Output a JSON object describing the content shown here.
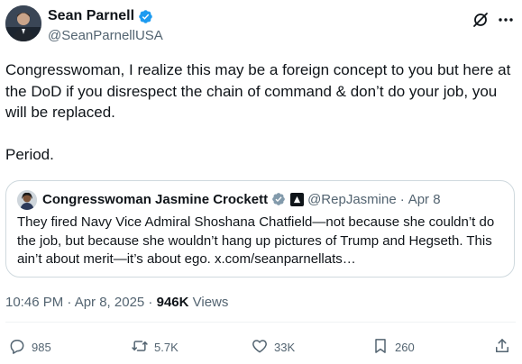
{
  "author": {
    "name": "Sean Parnell",
    "handle": "@SeanParnellUSA"
  },
  "tweet": {
    "paragraph_1": "Congresswoman, I realize this may be a foreign concept to you but here at the DoD if you disrespect the chain of command & don’t do your job, you will be replaced.",
    "paragraph_2": "Period."
  },
  "quote": {
    "name": "Congresswoman Jasmine Crockett",
    "handle": "@RepJasmine",
    "separator": "·",
    "date": "Apr 8",
    "text": "They fired Navy Vice Admiral Shoshana Chatfield—not because she couldn’t do the job, but because she wouldn’t hang up pictures of Trump and Hegseth. This ain’t about merit—it’s about ego. x.com/seanparnellats…"
  },
  "meta": {
    "timestamp": "10:46 PM · Apr 8, 2025",
    "separator": " · ",
    "views_count": "946K",
    "views_label": " Views"
  },
  "actions": {
    "replies": "985",
    "reposts": "5.7K",
    "likes": "33K",
    "bookmarks": "260"
  },
  "colors": {
    "verified_blue": "#1d9bf0",
    "secondary_text": "#536471",
    "border": "#cfd9de"
  },
  "icons": [
    "verified-badge-icon",
    "grok-icon",
    "more-icon",
    "government-badge-icon",
    "reply-icon",
    "repost-icon",
    "like-icon",
    "bookmark-icon",
    "share-icon"
  ]
}
